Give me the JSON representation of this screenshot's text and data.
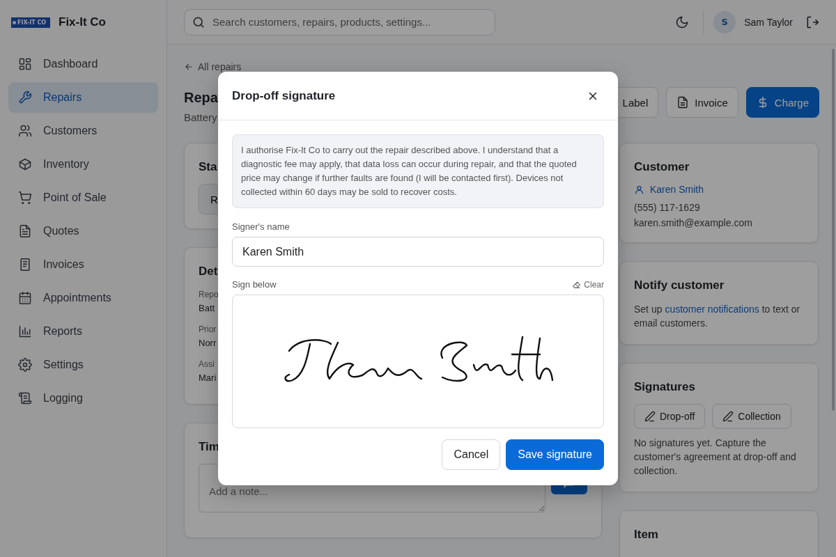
{
  "brand": {
    "logo_text": "FIX-IT CO",
    "name": "Fix-It Co"
  },
  "nav": [
    {
      "label": "Dashboard",
      "selected": false
    },
    {
      "label": "Repairs",
      "selected": true
    },
    {
      "label": "Customers",
      "selected": false
    },
    {
      "label": "Inventory",
      "selected": false
    },
    {
      "label": "Point of Sale",
      "selected": false
    },
    {
      "label": "Quotes",
      "selected": false
    },
    {
      "label": "Invoices",
      "selected": false
    },
    {
      "label": "Appointments",
      "selected": false
    },
    {
      "label": "Reports",
      "selected": false
    },
    {
      "label": "Settings",
      "selected": false
    },
    {
      "label": "Logging",
      "selected": false
    }
  ],
  "search": {
    "placeholder": "Search customers, repairs, products, settings..."
  },
  "user": {
    "initial": "S",
    "name": "Sam Taylor"
  },
  "page": {
    "back": "All repairs",
    "title": "Repa",
    "subtitle": "Battery",
    "actions": [
      {
        "label": "Label",
        "kind": "plain"
      },
      {
        "label": "Invoice",
        "kind": "invoice"
      },
      {
        "label": "Charge",
        "kind": "primary"
      }
    ]
  },
  "status_card": {
    "title": "Sta",
    "button": "R"
  },
  "details_card": {
    "title": "Det",
    "fields": [
      {
        "label": "Repo",
        "value": "Batt"
      },
      {
        "label": "Prior",
        "value": "Norr"
      },
      {
        "label": "Assi",
        "value": "Mari"
      }
    ]
  },
  "timeline_card": {
    "title": "Tim",
    "placeholder": "Add a note..."
  },
  "customer_card": {
    "title": "Customer",
    "name": "Karen Smith",
    "phone": "(555) 117-1629",
    "email": "karen.smith@example.com"
  },
  "notify_card": {
    "title": "Notify customer",
    "before": "Set up ",
    "link": "customer notifications",
    "after": " to text or email customers."
  },
  "signatures_card": {
    "title": "Signatures",
    "buttons": [
      "Drop-off",
      "Collection"
    ],
    "note": "No signatures yet. Capture the customer's agreement at drop-off and collection."
  },
  "item_card": {
    "title": "Item"
  },
  "modal": {
    "title": "Drop-off signature",
    "notice": "I authorise Fix-It Co to carry out the repair described above. I understand that a diagnostic fee may apply, that data loss can occur during repair, and that the quoted price may change if further faults are found (I will be contacted first). Devices not collected within 60 days may be sold to recover costs.",
    "name_label": "Signer's name",
    "name_value": "Karen Smith",
    "sign_label": "Sign below",
    "clear": "Clear",
    "cancel": "Cancel",
    "save": "Save signature"
  }
}
